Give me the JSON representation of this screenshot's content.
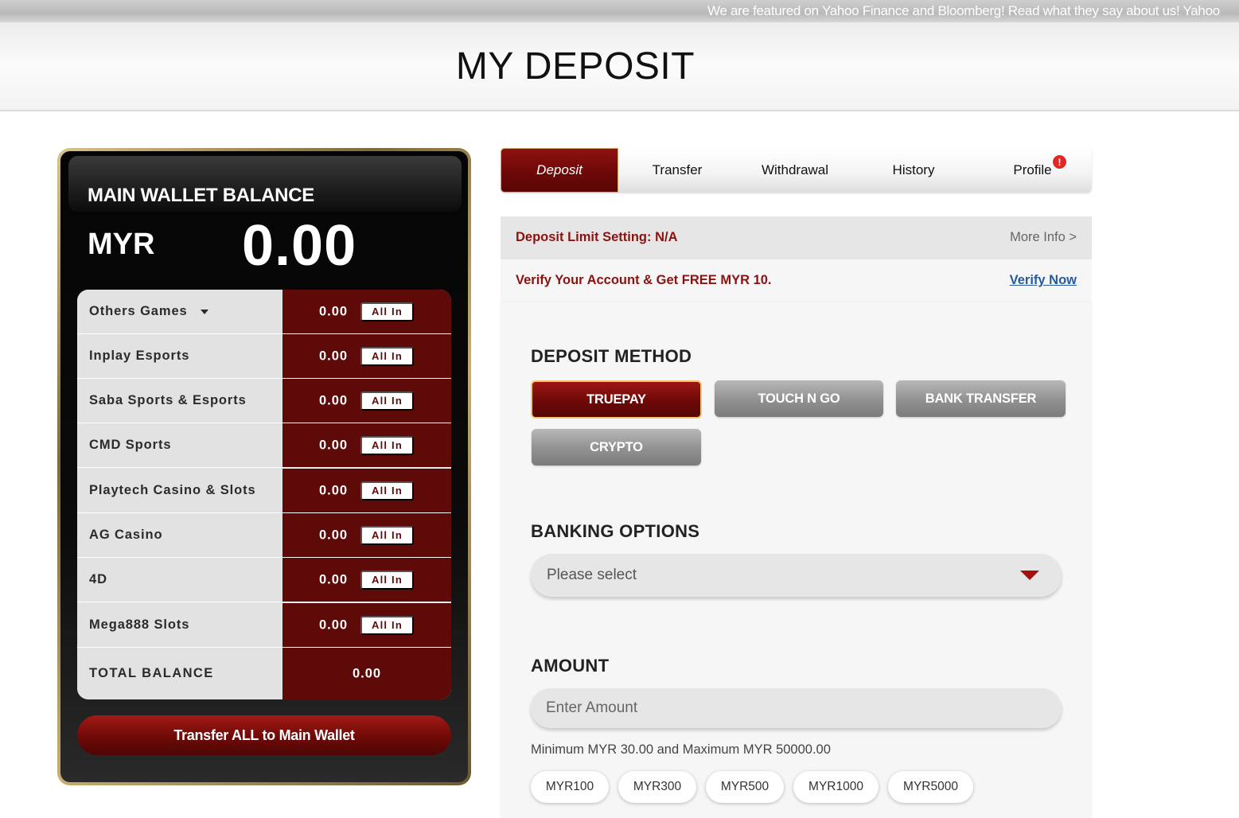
{
  "marquee": {
    "text": "We are featured on Yahoo Finance and Bloomberg! Read what they say about us! Yahoo"
  },
  "header": {
    "title": "MY DEPOSIT"
  },
  "wallet": {
    "title": "MAIN WALLET BALANCE",
    "currency": "MYR",
    "amount": "0.00",
    "all_in_label": "All In",
    "games": [
      {
        "name": "Others Games",
        "amount": "0.00",
        "has_dropdown": true
      },
      {
        "name": "Inplay Esports",
        "amount": "0.00"
      },
      {
        "name": "Saba Sports & Esports",
        "amount": "0.00"
      },
      {
        "name": "CMD Sports",
        "amount": "0.00"
      },
      {
        "name": "Playtech Casino & Slots",
        "amount": "0.00"
      },
      {
        "name": "AG Casino",
        "amount": "0.00"
      },
      {
        "name": "4D",
        "amount": "0.00"
      },
      {
        "name": "Mega888 Slots",
        "amount": "0.00"
      }
    ],
    "total_label": "TOTAL BALANCE",
    "total_amount": "0.00",
    "transfer_all_label": "Transfer ALL to Main Wallet"
  },
  "tabs": [
    {
      "label": "Deposit",
      "active": true
    },
    {
      "label": "Transfer"
    },
    {
      "label": "Withdrawal"
    },
    {
      "label": "History"
    },
    {
      "label": "Profile",
      "badge": "!"
    }
  ],
  "deposit_limit": {
    "label": "Deposit Limit Setting:  N/A",
    "more_info": "More Info >"
  },
  "verify": {
    "text": "Verify Your Account & Get FREE MYR 10.",
    "link": "Verify Now"
  },
  "deposit_method": {
    "title": "DEPOSIT METHOD",
    "options": [
      "TRUEPAY",
      "TOUCH N GO",
      "BANK TRANSFER",
      "CRYPTO"
    ],
    "selected": "TRUEPAY"
  },
  "banking_options": {
    "title": "BANKING OPTIONS",
    "placeholder": "Please select"
  },
  "amount": {
    "title": "AMOUNT",
    "placeholder": "Enter Amount",
    "hint": "Minimum MYR 30.00 and Maximum MYR 50000.00",
    "quick_amounts": [
      "MYR100",
      "MYR300",
      "MYR500",
      "MYR1000",
      "MYR5000"
    ]
  },
  "colors": {
    "accent": "#6a0807",
    "gold_border": "#c7ad6f",
    "badge": "#e02626",
    "link": "#285b9b"
  }
}
